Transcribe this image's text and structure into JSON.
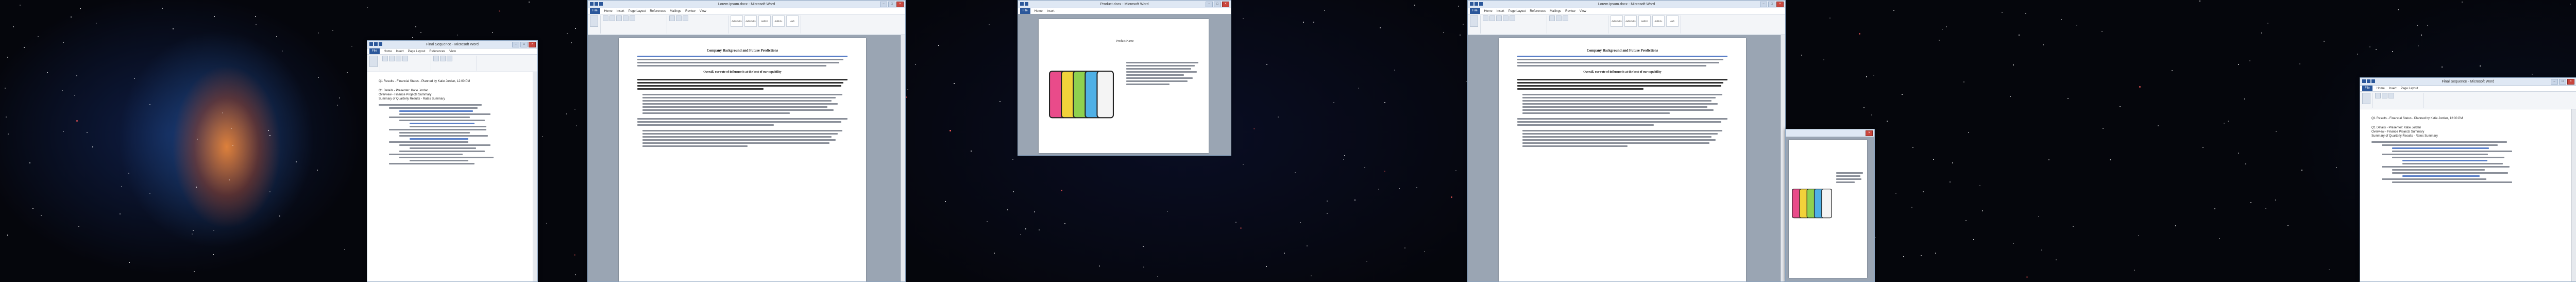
{
  "windows": {
    "outline_left": {
      "title": "Final Sequence - Microsoft Word"
    },
    "doc_left": {
      "title": "Lorem ipsum.docx - Microsoft Word",
      "heading": "Company Background and Future Predictions",
      "subheading": "Overall, our rate of influence is at the best of our capability"
    },
    "phones_center": {
      "title": "Product.docx - Microsoft Word",
      "caption": "Product Name"
    },
    "doc_right": {
      "title": "Lorem ipsum.docx - Microsoft Word",
      "heading": "Company Background and Future Predictions",
      "subheading": "Overall, our rate of influence is at the best of our capability"
    },
    "outline_right": {
      "title": "Final Sequence - Microsoft Word"
    }
  },
  "ribbon": {
    "file_tab": "File",
    "tabs": [
      "Home",
      "Insert",
      "Page Layout",
      "References",
      "Mailings",
      "Review",
      "View"
    ],
    "styles": [
      "AaBbCcDc",
      "AaBbCcDc",
      "AaBbC",
      "AaBbCc",
      "AaB"
    ]
  },
  "outline": {
    "title_line": "Q1 Results - Financial Status - Planned by Katie Jordan, 12:00 PM",
    "lines": [
      "Q1 Details - Presenter: Katie Jordan",
      "Overview - Finance Projects Summary",
      "Summary of Quarterly Results - Rates Summary"
    ]
  },
  "colors": {
    "ribbon_blue": "#2b579a",
    "phone_colors": [
      "#e94b8a",
      "#f2d23a",
      "#8fd14f",
      "#4fb0e6",
      "#f4f4f4"
    ]
  }
}
